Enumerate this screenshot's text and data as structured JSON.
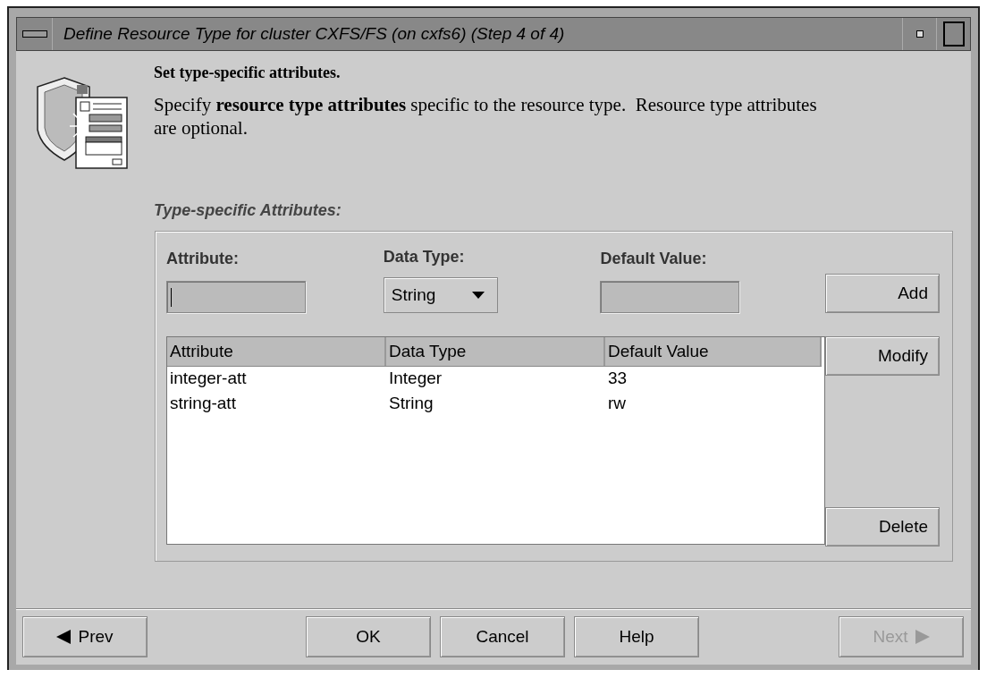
{
  "window": {
    "title": "Define Resource Type for cluster CXFS/FS (on cxfs6) (Step 4 of 4)"
  },
  "heading": "Set type-specific attributes.",
  "description": "Specify **resource type attributes** specific to the resource type.  Resource type attributes are optional.",
  "section_title": "Type-specific Attributes:",
  "form": {
    "attribute": {
      "label": "Attribute:",
      "focused": true
    },
    "data_type": {
      "label": "Data Type:",
      "value": "String"
    },
    "default_value": {
      "label": "Default Value:",
      "focused": false
    }
  },
  "side_buttons": [
    {
      "label": "Add",
      "disabled": false
    },
    {
      "label": "Modify",
      "disabled": false
    },
    {
      "label": "Delete",
      "disabled": false
    }
  ],
  "table": {
    "columns": [
      "Attribute",
      "Data Type",
      "Default Value"
    ],
    "rows": [
      {
        "cells": [
          "integer-att",
          "Integer",
          "33"
        ],
        "selected": false
      },
      {
        "cells": [
          "string-att",
          "String",
          "rw"
        ],
        "selected": false
      }
    ]
  },
  "footer_buttons": [
    {
      "label": "Prev",
      "kind": "prev",
      "disabled": false
    },
    {
      "label": "OK",
      "kind": "plain",
      "disabled": false
    },
    {
      "label": "Cancel",
      "kind": "plain",
      "disabled": false
    },
    {
      "label": "Help",
      "kind": "plain",
      "disabled": false
    },
    {
      "label": "Next",
      "kind": "next",
      "disabled": true
    }
  ]
}
